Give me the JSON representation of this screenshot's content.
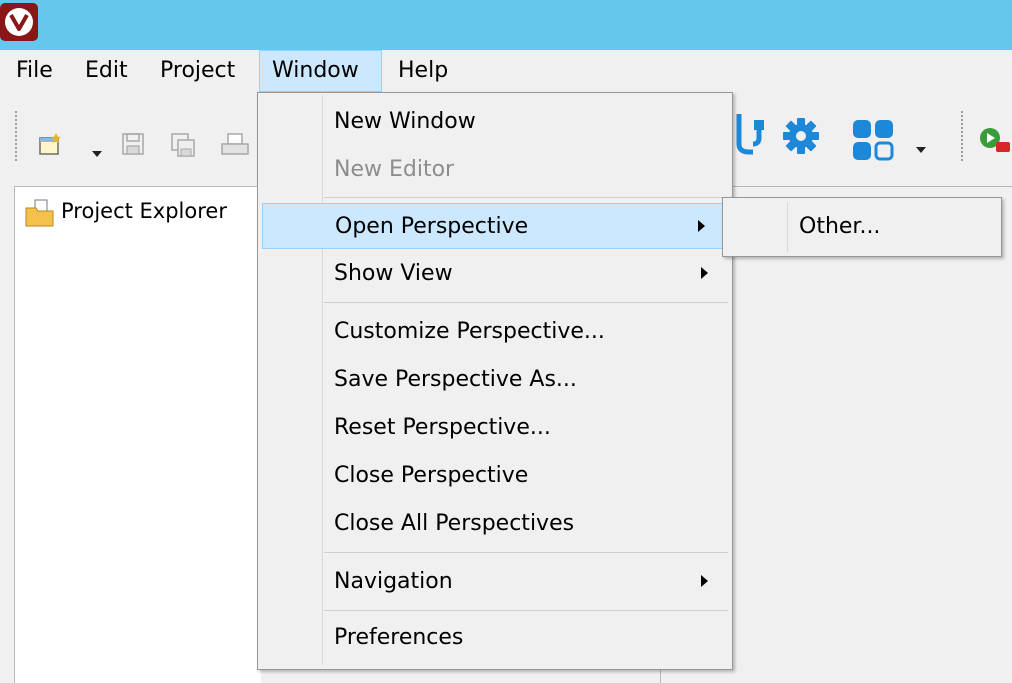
{
  "menubar": {
    "items": [
      {
        "label": "File"
      },
      {
        "label": "Edit"
      },
      {
        "label": "Project"
      },
      {
        "label": "Window"
      },
      {
        "label": "Help"
      }
    ]
  },
  "explorer": {
    "tab_label": "Project Explorer"
  },
  "window_menu": {
    "items": [
      {
        "label": "New Window"
      },
      {
        "label": "New Editor",
        "disabled": true
      },
      {
        "label": "Open Perspective",
        "submenu": true
      },
      {
        "label": "Show View",
        "submenu": true
      },
      {
        "label": "Customize Perspective..."
      },
      {
        "label": "Save Perspective As..."
      },
      {
        "label": "Reset Perspective..."
      },
      {
        "label": "Close Perspective"
      },
      {
        "label": "Close All Perspectives"
      },
      {
        "label": "Navigation",
        "submenu": true
      },
      {
        "label": "Preferences"
      }
    ]
  },
  "open_perspective_submenu": {
    "items": [
      {
        "label": "Other..."
      }
    ]
  },
  "colors": {
    "titlebar": "#63c8eb",
    "menu_highlight": "#cce8ff",
    "accent_blue": "#1e88d8",
    "app_icon": "#8a1717"
  }
}
